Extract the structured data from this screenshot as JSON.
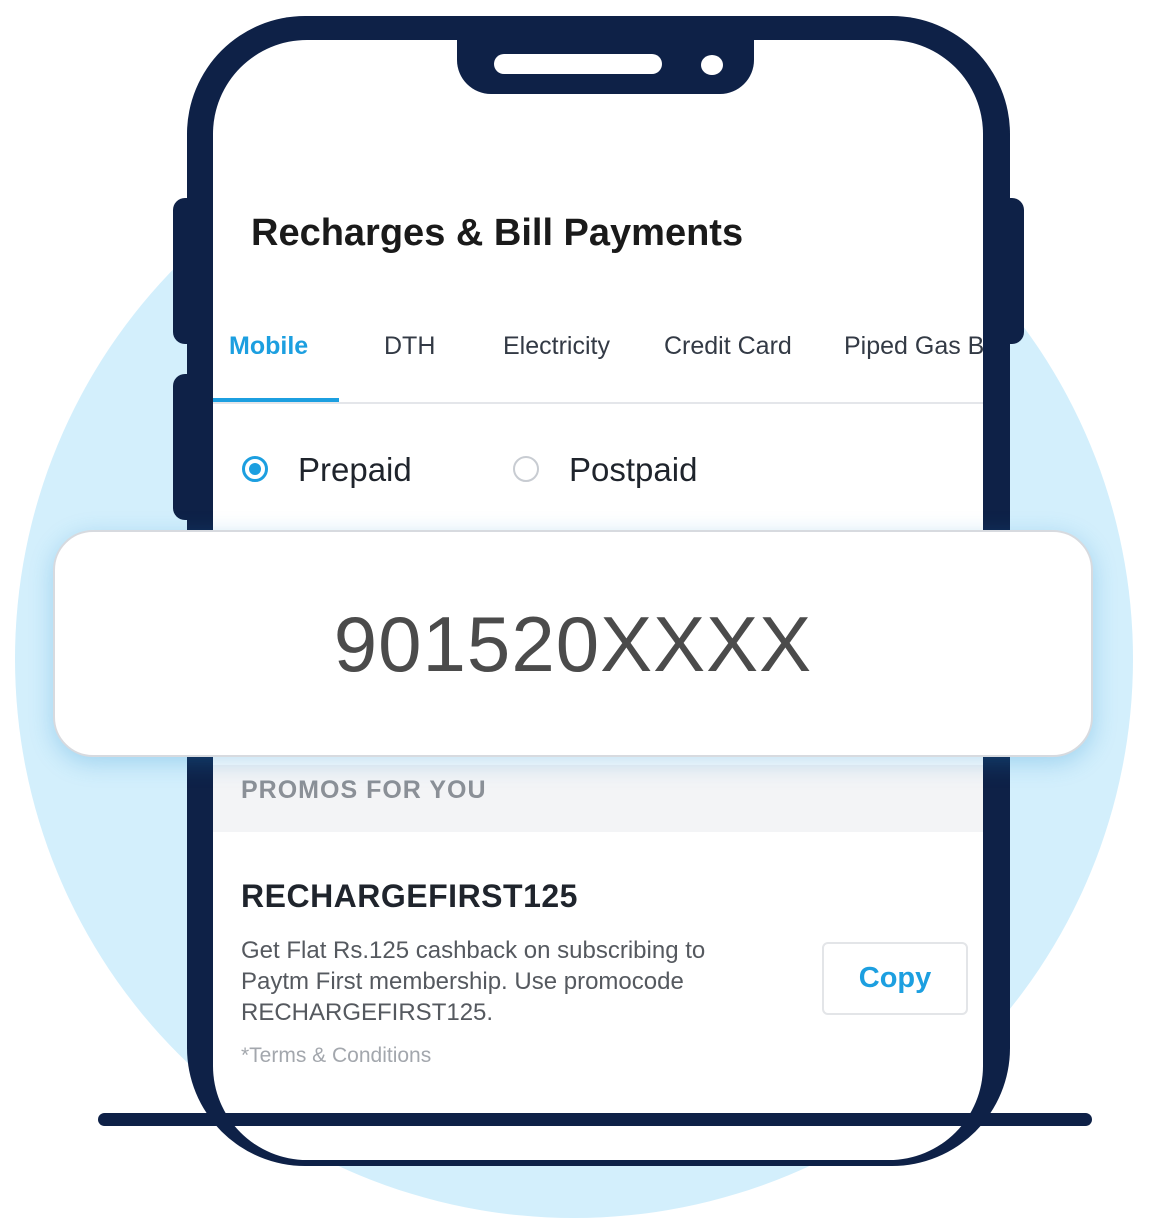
{
  "header": {
    "title": "Recharges & Bill Payments"
  },
  "tabs": [
    {
      "label": "Mobile",
      "active": true
    },
    {
      "label": "DTH"
    },
    {
      "label": "Electricity"
    },
    {
      "label": "Credit Card"
    },
    {
      "label": "Piped Gas B"
    }
  ],
  "plan_type": {
    "options": [
      "Prepaid",
      "Postpaid"
    ],
    "selected": "Prepaid"
  },
  "mobile_number": {
    "value": "901520XXXX"
  },
  "promos": {
    "section_title": "PROMOS FOR YOU",
    "items": [
      {
        "code": "RECHARGEFIRST125",
        "description": "Get Flat Rs.125 cashback on subscribing to Paytm First membership. Use promocode RECHARGEFIRST125.",
        "copy_label": "Copy",
        "terms_label": "*Terms & Conditions"
      }
    ]
  },
  "colors": {
    "accent": "#1c9fe0",
    "phone_frame": "#0e2147",
    "background_circle": "#d3effc"
  }
}
